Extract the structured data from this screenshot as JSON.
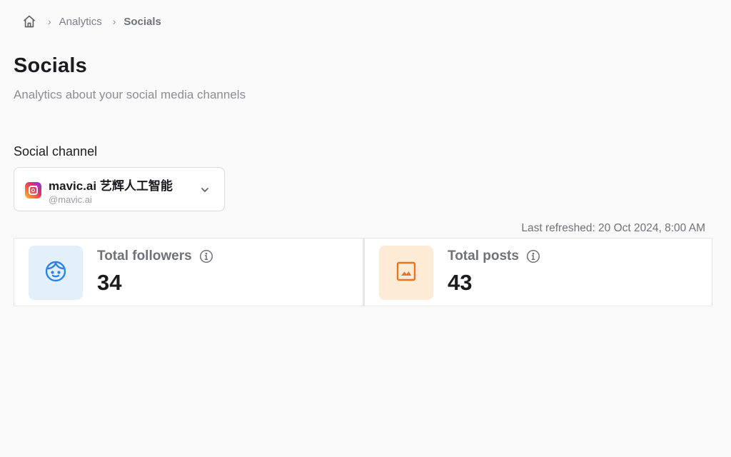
{
  "breadcrumb": {
    "home_icon": "home-icon",
    "separator": "›",
    "items": [
      "Analytics",
      "Socials"
    ]
  },
  "page": {
    "title": "Socials",
    "subtitle": "Analytics about your social media channels"
  },
  "social_channel": {
    "label": "Social channel",
    "selected": {
      "name": "mavic.ai 艺辉人工智能",
      "handle": "@mavic.ai",
      "platform_icon": "instagram-icon"
    },
    "dropdown_icon": "chevron-down-icon"
  },
  "last_refreshed": "Last refreshed: 20 Oct 2024, 8:00 AM",
  "stats": [
    {
      "label": "Total followers",
      "value": "34",
      "icon": "face-icon",
      "accent": "#2b83e8",
      "bg": "#e3f0fc"
    },
    {
      "label": "Total posts",
      "value": "43",
      "icon": "image-icon",
      "accent": "#e8751f",
      "bg": "#fdebd6"
    }
  ]
}
